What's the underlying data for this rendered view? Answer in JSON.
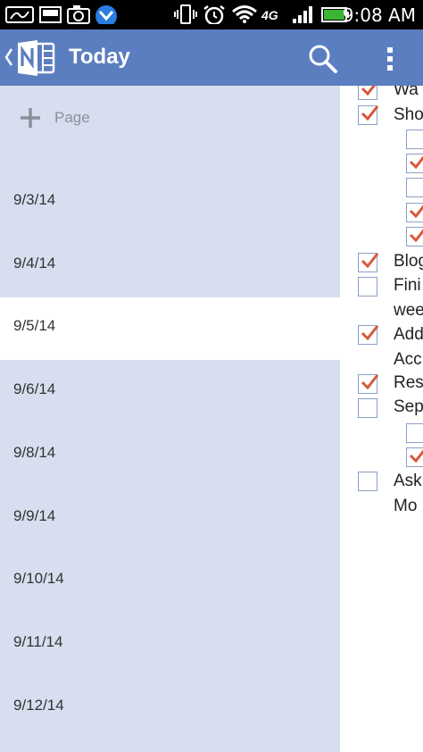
{
  "status_bar": {
    "time": "9:08 AM",
    "network": "4G",
    "icons": [
      "signature-icon",
      "media-icon",
      "camera-icon",
      "app-notification-icon",
      "vibrate-icon",
      "alarm-icon",
      "wifi-icon",
      "4g-icon",
      "signal-icon",
      "battery-icon"
    ]
  },
  "app_bar": {
    "title": "Today",
    "back_icon": "chevron-left-icon",
    "logo_icon": "onenote-logo-icon",
    "search_icon": "search-icon",
    "more_icon": "more-vert-icon",
    "color": "#5b7ec0"
  },
  "page_list": {
    "add_page_label": "Page",
    "background": "#d7deef",
    "pages": [
      {
        "label": "9/3/14",
        "selected": false
      },
      {
        "label": "9/4/14",
        "selected": false
      },
      {
        "label": "9/5/14",
        "selected": true
      },
      {
        "label": "9/6/14",
        "selected": false
      },
      {
        "label": "9/8/14",
        "selected": false
      },
      {
        "label": "9/9/14",
        "selected": false
      },
      {
        "label": "9/10/14",
        "selected": false
      },
      {
        "label": "9/11/14",
        "selected": false
      },
      {
        "label": "9/12/14",
        "selected": false
      }
    ]
  },
  "note": {
    "items": [
      {
        "text": "Wa",
        "checked": true
      },
      {
        "text": "Sho",
        "checked": true
      },
      {
        "text": "",
        "checked": false
      },
      {
        "text": "",
        "checked": true
      },
      {
        "text": "",
        "checked": false
      },
      {
        "text": "",
        "checked": true
      },
      {
        "text": "",
        "checked": true
      },
      {
        "text": "Blog",
        "checked": true
      },
      {
        "text": "Fini",
        "checked": false
      },
      {
        "text": "wee",
        "checked": null
      },
      {
        "text": "Add",
        "checked": true
      },
      {
        "text": "Acc",
        "checked": null
      },
      {
        "text": "Res",
        "checked": true
      },
      {
        "text": "Sep",
        "checked": false
      },
      {
        "text": "",
        "checked": false
      },
      {
        "text": "",
        "checked": true
      },
      {
        "text": "Ask",
        "checked": false
      },
      {
        "text": "Mo",
        "checked": null
      }
    ],
    "check_color": "#d9583b"
  }
}
